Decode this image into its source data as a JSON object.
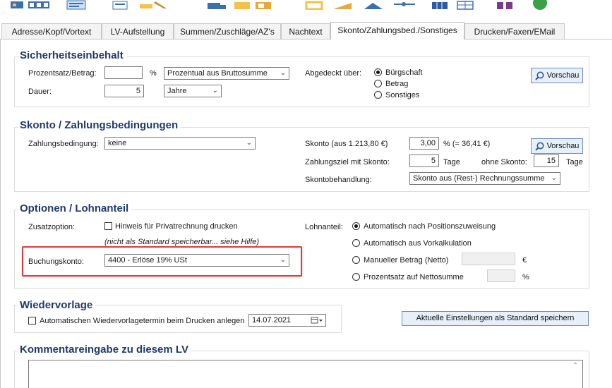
{
  "toolbar": {
    "icons": [
      "image-icon",
      "grid-icon",
      "list-icon",
      "document-icon",
      "pen-icon",
      "truck-icon",
      "folder-icon",
      "folder-open-icon",
      "box-icon",
      "ruler-icon",
      "chart-icon",
      "hierarchy-icon",
      "table-icon",
      "calculator-icon",
      "gift-icon",
      "check-circle-icon"
    ]
  },
  "tabs": [
    {
      "label": "Adresse/Kopf/Vortext"
    },
    {
      "label": "LV-Aufstellung"
    },
    {
      "label": "Summen/Zuschläge/AZ's"
    },
    {
      "label": "Nachtext"
    },
    {
      "label": "Skonto/Zahlungsbed./Sonstiges"
    },
    {
      "label": "Drucken/Faxen/EMail"
    }
  ],
  "active_tab": "Skonto/Zahlungsbed./Sonstiges",
  "sicherheit": {
    "title": "Sicherheitseinbehalt",
    "prozent_label": "Prozentsatz/Betrag:",
    "prozent_value": "",
    "percent_symbol": "%",
    "mode_select": "Prozentual aus Bruttosumme",
    "dauer_label": "Dauer:",
    "dauer_value": "5",
    "dauer_unit": "Jahre",
    "abgedeckt_label": "Abgedeckt über:",
    "options": [
      "Bürgschaft",
      "Betrag",
      "Sonstiges"
    ],
    "selected": "Bürgschaft",
    "preview_button": "Vorschau"
  },
  "skonto": {
    "title": "Skonto / Zahlungsbedingungen",
    "zahlung_label": "Zahlungsbedingung:",
    "zahlung_value": "keine",
    "skonto_label": "Skonto (aus 1.213,80 €)",
    "skonto_value": "3,00",
    "skonto_result": "%  (= 36,41 €)",
    "ziel_label": "Zahlungsziel mit Skonto:",
    "ziel_value": "5",
    "ziel_unit": "Tage",
    "ohne_label": "ohne Skonto:",
    "ohne_value": "15",
    "ohne_unit": "Tage",
    "behandlung_label": "Skontobehandlung:",
    "behandlung_value": "Skonto aus (Rest-) Rechnungssumme",
    "preview_button": "Vorschau"
  },
  "optionen": {
    "title": "Optionen / Lohnanteil",
    "zusatz_label": "Zusatzoption:",
    "privat_checkbox": "Hinweis für Privatrechnung drucken",
    "hint": "(nicht als Standard speicherbar... siehe Hilfe)",
    "buchung_label": "Buchungskonto:",
    "buchung_value": "4400 - Erlöse 19% USt",
    "lohn_label": "Lohnanteil:",
    "lohn_options": [
      "Automatisch nach Positionszuweisung",
      "Automatisch aus Vorkalkulation",
      "Manueller Betrag (Netto)",
      "Prozentsatz auf Nettosumme"
    ],
    "lohn_selected": "Automatisch nach Positionszuweisung",
    "euro_symbol": "€",
    "percent_symbol": "%"
  },
  "wiedervorlage": {
    "title": "Wiedervorlage",
    "checkbox_label": "Automatischen Wiedervorlagetermin beim Drucken anlegen",
    "date": "14.07.2021",
    "save_button": "Aktuelle Einstellungen als Standard speichern"
  },
  "kommentar": {
    "title": "Kommentareingabe zu diesem LV"
  },
  "colors": {
    "section_title": "#1f3a6b",
    "highlight": "#e03b3b",
    "button_blue": "#e7eff9"
  }
}
